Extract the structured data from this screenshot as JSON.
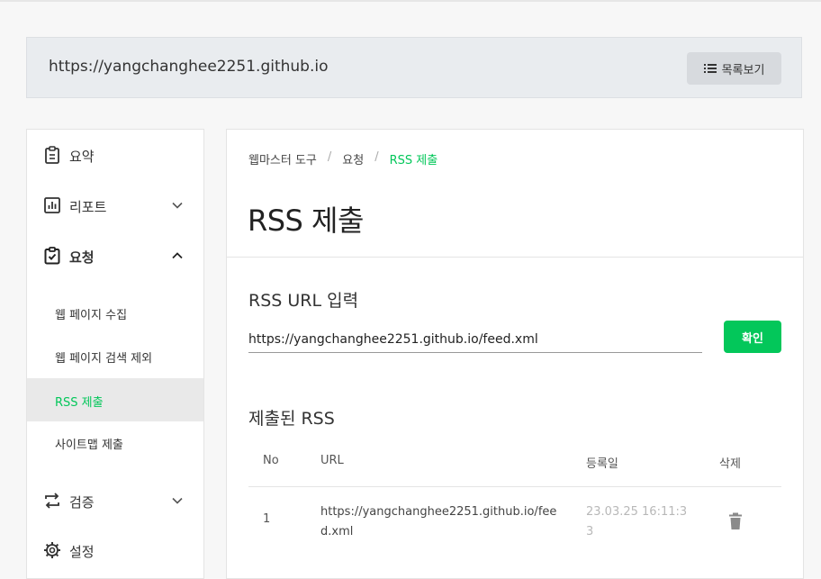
{
  "site": {
    "url": "https://yangchanghee2251.github.io",
    "list_button_label": "목록보기"
  },
  "sidebar": {
    "items": [
      {
        "label": "요약",
        "icon": "clipboard-icon"
      },
      {
        "label": "리포트",
        "icon": "bar-chart-icon"
      },
      {
        "label": "요청",
        "icon": "clipboard-check-icon"
      },
      {
        "label": "검증",
        "icon": "swap-icon"
      },
      {
        "label": "설정",
        "icon": "gear-icon"
      }
    ],
    "sub_items": [
      {
        "label": "웹 페이지 수집"
      },
      {
        "label": "웹 페이지 검색 제외"
      },
      {
        "label": "RSS 제출"
      },
      {
        "label": "사이트맵 제출"
      }
    ]
  },
  "breadcrumb": [
    "웹마스터 도구",
    "요청",
    "RSS 제출"
  ],
  "page_title": "RSS 제출",
  "form": {
    "label": "RSS URL 입력",
    "value": "https://yangchanghee2251.github.io/feed.xml",
    "confirm_label": "확인"
  },
  "submitted": {
    "title": "제출된 RSS",
    "columns": [
      "No",
      "URL",
      "등록일",
      "삭제"
    ],
    "rows": [
      {
        "no": "1",
        "url": "https://yangchanghee2251.github.io/feed.xml",
        "date": "23.03.25 16:11:33"
      }
    ]
  },
  "colors": {
    "accent": "#03c75a",
    "site_bar": "#e9ecef"
  }
}
